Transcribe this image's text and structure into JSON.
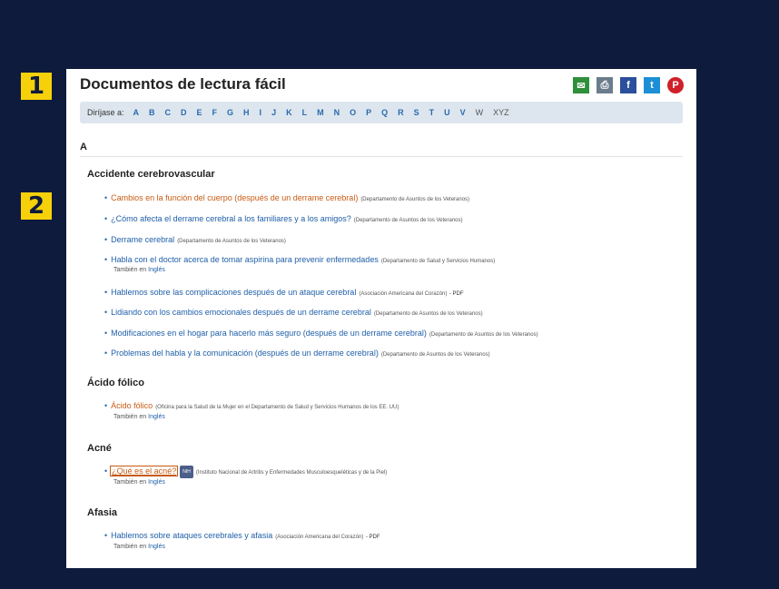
{
  "badges": [
    "1",
    "2"
  ],
  "page": {
    "title": "Documentos de lectura fácil",
    "share_icons": [
      "email-icon",
      "print-icon",
      "facebook-icon",
      "twitter-icon",
      "pinterest-icon"
    ]
  },
  "alphabet": {
    "label": "Diríjase a:",
    "letters": [
      "A",
      "B",
      "C",
      "D",
      "E",
      "F",
      "G",
      "H",
      "I",
      "J",
      "K",
      "L",
      "M",
      "N",
      "O",
      "P",
      "Q",
      "R",
      "S",
      "T",
      "U",
      "V",
      "W",
      "XYZ"
    ]
  },
  "letter_head": "A",
  "sections": [
    {
      "title": "Accidente cerebrovascular",
      "items": [
        {
          "link": "Cambios en la función del cuerpo (después de un derrame cerebral)",
          "source": "(Departamento de Asuntos de los Veteranos)"
        },
        {
          "link": "¿Cómo afecta el derrame cerebral a los familiares y a los amigos?",
          "source": "(Departamento de Asuntos de los Veteranos)"
        },
        {
          "link": "Derrame cerebral",
          "source": "(Departamento de Asuntos de los Veteranos)"
        },
        {
          "link": "Habla con el doctor acerca de tomar aspirina para prevenir enfermedades",
          "source": "(Departamento de Salud y Servicios Humanos)",
          "also": "También en",
          "also_link": "Inglés"
        },
        {
          "link": "Hablemos sobre las complicaciones después de un ataque cerebral",
          "source": "(Asociación Americana del Corazón)",
          "pdf": "- PDF"
        },
        {
          "link": "Lidiando con los cambios emocionales después de un derrame cerebral",
          "source": "(Departamento de Asuntos de los Veteranos)"
        },
        {
          "link": "Modificaciones en el hogar para hacerlo más seguro (después de un derrame cerebral)",
          "source": "(Departamento de Asuntos de los Veteranos)"
        },
        {
          "link": "Problemas del habla y la comunicación (después de un derrame cerebral)",
          "source": "(Departamento de Asuntos de los Veteranos)"
        }
      ]
    },
    {
      "title": "Ácido fólico",
      "items": [
        {
          "link": "Ácido fólico",
          "source": "(Oficina para la Salud de la Mujer en el Departamento de Salud y Servicios Humanos de los EE. UU)",
          "also": "También en",
          "also_link": "Inglés"
        }
      ]
    },
    {
      "title": "Acné",
      "items": [
        {
          "link": "¿Qué es el acné?",
          "badge": "NIH",
          "source": "(Instituto Nacional de Artritis y Enfermedades Musculoesqueléticas y de la Piel)",
          "also": "También en",
          "also_link": "Inglés"
        }
      ]
    },
    {
      "title": "Afasia",
      "items": [
        {
          "link": "Hablemos sobre ataques cerebrales y afasia",
          "source": "(Asociación Americana del Corazón)",
          "pdf": "- PDF",
          "also": "También en",
          "also_link": "Inglés"
        }
      ]
    }
  ]
}
